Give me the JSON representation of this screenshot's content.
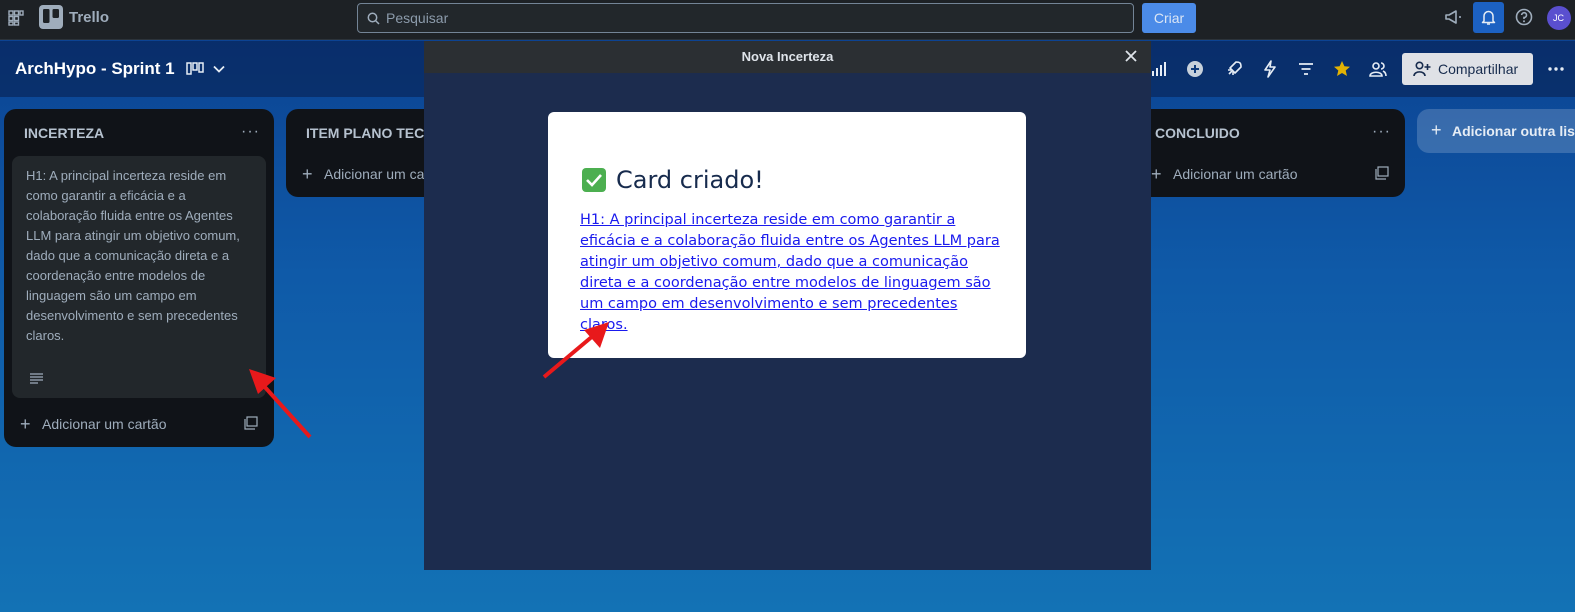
{
  "topnav": {
    "app_name": "Trello",
    "search_placeholder": "Pesquisar",
    "create_label": "Criar",
    "avatar_initials": "JC"
  },
  "board": {
    "title": "ArchHypo - Sprint 1",
    "share_label": "Compartilhar"
  },
  "lists": [
    {
      "title": "INCERTEZA",
      "cards": [
        "H1: A principal incerteza reside em como garantir a eficácia e a colaboração fluida entre os Agentes LLM para atingir um objetivo comum, dado que a comunicação direta e a coordenação entre modelos de linguagem são um campo em desenvolvimento e sem precedentes claros."
      ],
      "add_card_label": "Adicionar um cartão"
    },
    {
      "title": "ITEM PLANO TECN",
      "add_card_label": "Adicionar um ca"
    },
    {
      "title": "CONCLUIDO",
      "add_card_label": "Adicionar um cartão"
    }
  ],
  "add_list_label": "Adicionar outra lista",
  "modal": {
    "title": "Nova Incerteza",
    "result_heading": "Card criado!",
    "result_link": "H1: A principal incerteza reside em como garantir a eficácia e a colaboração fluida entre os Agentes LLM para atingir um objetivo comum, dado que a comunicação direta e a coordenação entre modelos de linguagem são um campo em desenvolvimento e sem precedentes claros."
  },
  "colors": {
    "topnav_bg": "#1d2125",
    "list_bg": "#101318",
    "card_bg": "#22272b",
    "modal_bg": "#1c2c4e",
    "accent": "#579dff",
    "annotation_arrow": "#e8191b"
  }
}
